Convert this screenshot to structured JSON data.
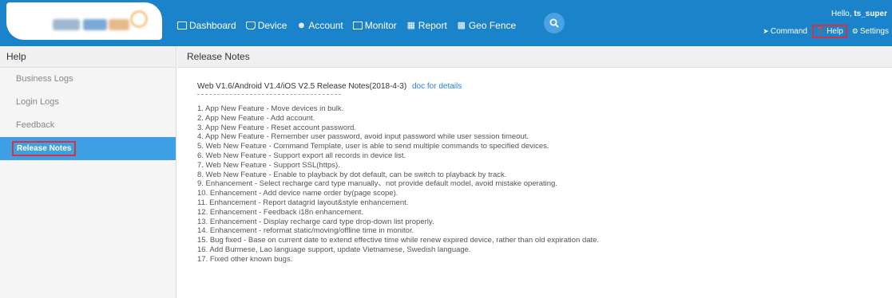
{
  "header": {
    "nav": [
      {
        "label": "Dashboard",
        "icon": "dashboard-icon"
      },
      {
        "label": "Device",
        "icon": "device-icon"
      },
      {
        "label": "Account",
        "icon": "account-icon"
      },
      {
        "label": "Monitor",
        "icon": "monitor-icon"
      },
      {
        "label": "Report",
        "icon": "report-icon"
      },
      {
        "label": "Geo Fence",
        "icon": "geofence-icon"
      }
    ],
    "greeting": "Hello,",
    "username": "ts_super",
    "command_label": "Command",
    "help_label": "Help",
    "settings_label": "Settings"
  },
  "sidebar": {
    "title": "Help",
    "items": [
      {
        "label": "Business Logs"
      },
      {
        "label": "Login Logs"
      },
      {
        "label": "Feedback"
      },
      {
        "label": "Release Notes"
      }
    ]
  },
  "main": {
    "title": "Release Notes",
    "heading": "Web V1.6/Android V1.4/iOS V2.5 Release Notes(2018-4-3)",
    "doc_link": "doc for details",
    "notes": [
      "1. App New Feature - Move devices in bulk.",
      "2. App New Feature - Add account.",
      "3. App New Feature - Reset account password.",
      "4. App New Feature - Remember user password, avoid input password while user session timeout.",
      "5. Web New Feature - Command Template, user is able to send multiple commands to specified devices.",
      "6. Web New Feature - Support export all records in device list.",
      "7. Web New Feature - Support SSL(https).",
      "8. Web New Feature - Enable to playback by dot default, can be switch to playback by track.",
      "9. Enhancement - Select recharge card type manually、not provide default model, avoid mistake operating.",
      "10. Enhancement - Add device name order by(page scope).",
      "11. Enhancement - Report datagrid layout&style enhancement.",
      "12. Enhancement - Feedback i18n enhancement.",
      "13. Enhancement - Display recharge card type drop-down list properly.",
      "14. Enhancement - reformat static/moving/offline time in monitor.",
      "15. Bug fixed - Base on current date to extend effective time while renew expired device, rather than old expiration date.",
      "16. Add Burmese, Lao language support, update Vietnamese, Swedish language.",
      "17. Fixed other known bugs."
    ]
  },
  "colors": {
    "header_bg": "#1b83c9",
    "active_bg": "#3ea0e4",
    "highlight_border": "#d6333c",
    "link": "#2a7fd4"
  }
}
